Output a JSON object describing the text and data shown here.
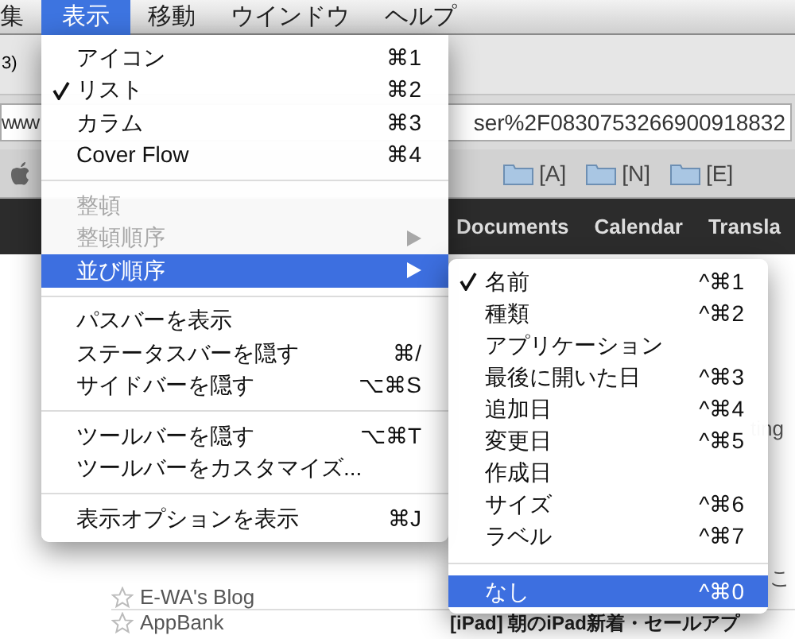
{
  "menu_bar": [
    {
      "label": "集",
      "selected": false
    },
    {
      "label": "表示",
      "selected": true
    },
    {
      "label": "移動",
      "selected": false
    },
    {
      "label": "ウインドウ",
      "selected": false
    },
    {
      "label": "ヘルプ",
      "selected": false
    }
  ],
  "browser": {
    "tab_label": "3)",
    "url_start": "www",
    "url_end": "ser%2F083075326690091883​2",
    "bookmarks": [
      "[A]",
      "[N]",
      "[E]"
    ],
    "nav_links": [
      "Documents",
      "Calendar",
      "Transla"
    ],
    "side_fragments": [
      "ting",
      "こ"
    ],
    "rows": [
      {
        "title": "E-WA's Blog",
        "snippet": ""
      },
      {
        "title": "AppBank",
        "snippet": "[iPad] 朝のiPad新着・セールアプ"
      }
    ]
  },
  "view_menu": {
    "items": [
      {
        "kind": "item",
        "label": "アイコン",
        "shortcut": "⌘1",
        "checked": false,
        "disabled": false,
        "selected": false,
        "submenu": false
      },
      {
        "kind": "item",
        "label": "リスト",
        "shortcut": "⌘2",
        "checked": true,
        "disabled": false,
        "selected": false,
        "submenu": false
      },
      {
        "kind": "item",
        "label": "カラム",
        "shortcut": "⌘3",
        "checked": false,
        "disabled": false,
        "selected": false,
        "submenu": false
      },
      {
        "kind": "item",
        "label": "Cover Flow",
        "shortcut": "⌘4",
        "checked": false,
        "disabled": false,
        "selected": false,
        "submenu": false
      },
      {
        "kind": "separator"
      },
      {
        "kind": "item",
        "label": "整頓",
        "checked": false,
        "disabled": true,
        "selected": false,
        "submenu": false
      },
      {
        "kind": "item",
        "label": "整頓順序",
        "checked": false,
        "disabled": true,
        "selected": false,
        "submenu": true
      },
      {
        "kind": "item",
        "label": "並び順序",
        "checked": false,
        "disabled": false,
        "selected": true,
        "submenu": true
      },
      {
        "kind": "separator"
      },
      {
        "kind": "item",
        "label": "パスバーを表示",
        "checked": false,
        "disabled": false,
        "selected": false,
        "submenu": false
      },
      {
        "kind": "item",
        "label": "ステータスバーを隠す",
        "shortcut": "⌘/",
        "checked": false,
        "disabled": false,
        "selected": false,
        "submenu": false
      },
      {
        "kind": "item",
        "label": "サイドバーを隠す",
        "shortcut": "⌥⌘S",
        "checked": false,
        "disabled": false,
        "selected": false,
        "submenu": false
      },
      {
        "kind": "separator"
      },
      {
        "kind": "item",
        "label": "ツールバーを隠す",
        "shortcut": "⌥⌘T",
        "checked": false,
        "disabled": false,
        "selected": false,
        "submenu": false
      },
      {
        "kind": "item",
        "label": "ツールバーをカスタマイズ...",
        "checked": false,
        "disabled": false,
        "selected": false,
        "submenu": false
      },
      {
        "kind": "separator"
      },
      {
        "kind": "item",
        "label": "表示オプションを表示",
        "shortcut": "⌘J",
        "checked": false,
        "disabled": false,
        "selected": false,
        "submenu": false
      }
    ]
  },
  "sort_submenu": {
    "items": [
      {
        "kind": "item",
        "label": "名前",
        "shortcut": "^⌘1",
        "checked": true,
        "disabled": false,
        "selected": false,
        "submenu": false
      },
      {
        "kind": "item",
        "label": "種類",
        "shortcut": "^⌘2",
        "checked": false,
        "disabled": false,
        "selected": false,
        "submenu": false
      },
      {
        "kind": "item",
        "label": "アプリケーション",
        "checked": false,
        "disabled": false,
        "selected": false,
        "submenu": false
      },
      {
        "kind": "item",
        "label": "最後に開いた日",
        "shortcut": "^⌘3",
        "checked": false,
        "disabled": false,
        "selected": false,
        "submenu": false
      },
      {
        "kind": "item",
        "label": "追加日",
        "shortcut": "^⌘4",
        "checked": false,
        "disabled": false,
        "selected": false,
        "submenu": false
      },
      {
        "kind": "item",
        "label": "変更日",
        "shortcut": "^⌘5",
        "checked": false,
        "disabled": false,
        "selected": false,
        "submenu": false
      },
      {
        "kind": "item",
        "label": "作成日",
        "checked": false,
        "disabled": false,
        "selected": false,
        "submenu": false
      },
      {
        "kind": "item",
        "label": "サイズ",
        "shortcut": "^⌘6",
        "checked": false,
        "disabled": false,
        "selected": false,
        "submenu": false
      },
      {
        "kind": "item",
        "label": "ラベル",
        "shortcut": "^⌘7",
        "checked": false,
        "disabled": false,
        "selected": false,
        "submenu": false
      },
      {
        "kind": "separator"
      },
      {
        "kind": "item",
        "label": "なし",
        "shortcut": "^⌘0",
        "checked": false,
        "disabled": false,
        "selected": true,
        "submenu": false
      }
    ]
  }
}
